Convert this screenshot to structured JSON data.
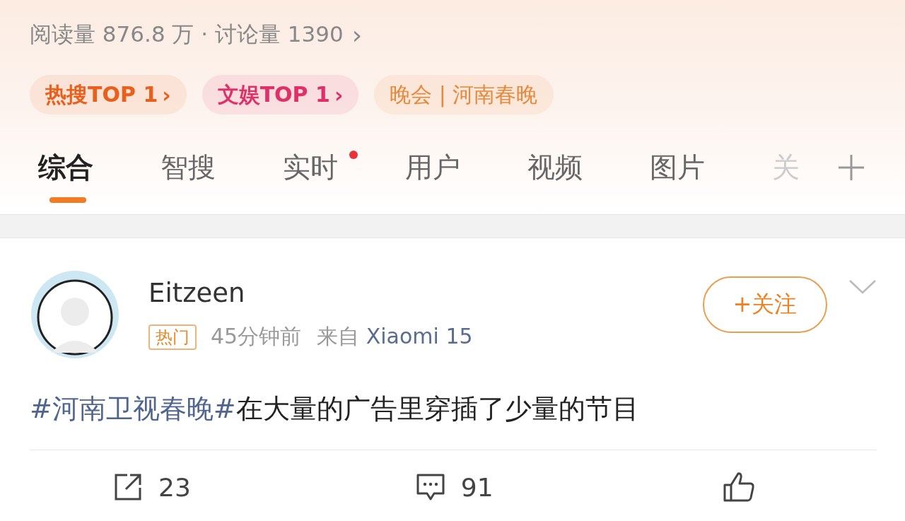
{
  "topic_stats": {
    "text": "阅读量 876.8 万 · 讨论量 1390",
    "chevron": "›"
  },
  "chips": [
    {
      "label": "热搜TOP 1",
      "arrow": "›",
      "kind": "rank",
      "color": "#e8601c"
    },
    {
      "label": "文娱TOP 1",
      "arrow": "›",
      "kind": "rank",
      "color": "#e0306a"
    },
    {
      "label": "晚会 | 河南春晚",
      "kind": "category",
      "color": "#e8883a"
    }
  ],
  "tabs": [
    {
      "label": "综合",
      "selected": true,
      "dot": false,
      "faded": false
    },
    {
      "label": "智搜",
      "selected": false,
      "dot": false,
      "faded": false
    },
    {
      "label": "实时",
      "selected": false,
      "dot": true,
      "faded": false
    },
    {
      "label": "用户",
      "selected": false,
      "dot": false,
      "faded": false
    },
    {
      "label": "视频",
      "selected": false,
      "dot": false,
      "faded": false
    },
    {
      "label": "图片",
      "selected": false,
      "dot": false,
      "faded": false
    },
    {
      "label": "关",
      "selected": false,
      "dot": false,
      "faded": true
    }
  ],
  "post": {
    "author": "Eitzeen",
    "badge": "热门",
    "time": "45分钟前",
    "source_prefix": "来自",
    "source": "Xiaomi 15",
    "follow_button": "+关注",
    "hashtag": "#河南卫视春晚#",
    "text": "在大量的广告里穿插了少量的节目",
    "actions": [
      {
        "kind": "share",
        "count": "23"
      },
      {
        "kind": "comment",
        "count": "91"
      },
      {
        "kind": "like"
      }
    ]
  }
}
